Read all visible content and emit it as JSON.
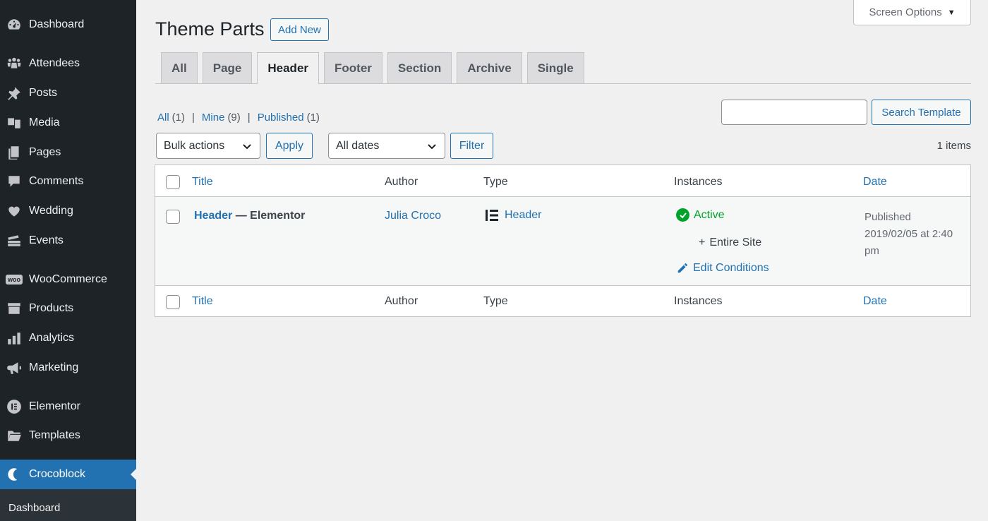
{
  "sidebar": {
    "items": [
      {
        "label": "Dashboard",
        "icon": "dashboard-icon"
      },
      {
        "label": "Attendees",
        "icon": "groups-icon"
      },
      {
        "label": "Posts",
        "icon": "pin-icon"
      },
      {
        "label": "Media",
        "icon": "media-icon"
      },
      {
        "label": "Pages",
        "icon": "pages-icon"
      },
      {
        "label": "Comments",
        "icon": "comments-icon"
      },
      {
        "label": "Wedding",
        "icon": "heart-icon"
      },
      {
        "label": "Events",
        "icon": "tickets-icon"
      },
      {
        "label": "WooCommerce",
        "icon": "woo-icon"
      },
      {
        "label": "Products",
        "icon": "archive-icon"
      },
      {
        "label": "Analytics",
        "icon": "chart-bar-icon"
      },
      {
        "label": "Marketing",
        "icon": "megaphone-icon"
      },
      {
        "label": "Elementor",
        "icon": "elementor-icon"
      },
      {
        "label": "Templates",
        "icon": "folder-icon"
      },
      {
        "label": "Crocoblock",
        "icon": "crocoblock-icon"
      }
    ],
    "submenu": {
      "label": "Dashboard"
    },
    "woo_badge": "woo"
  },
  "screen_options": {
    "label": "Screen Options"
  },
  "header": {
    "title": "Theme Parts",
    "add_new": "Add New"
  },
  "tabs": [
    "All",
    "Page",
    "Header",
    "Footer",
    "Section",
    "Archive",
    "Single"
  ],
  "active_tab": "Header",
  "filters": {
    "all": "All",
    "all_count": "(1)",
    "mine": "Mine",
    "mine_count": "(9)",
    "published": "Published",
    "published_count": "(1)",
    "sep": "|"
  },
  "search": {
    "placeholder": "",
    "button": "Search Template"
  },
  "toolbar": {
    "bulk_actions": "Bulk actions",
    "apply": "Apply",
    "dates": "All dates",
    "filter": "Filter",
    "items_count": "1 items"
  },
  "table": {
    "columns": [
      "Title",
      "Author",
      "Type",
      "Instances",
      "Date"
    ],
    "rows": [
      {
        "title": "Header",
        "title_suffix": "— Elementor",
        "author": "Julia Croco",
        "type": "Header",
        "instance_status": "Active",
        "instance_condition": "Entire Site",
        "edit_conditions": "Edit Conditions",
        "date_status": "Published",
        "date_line1": "2019/02/05 at 2:40",
        "date_line2": "pm"
      }
    ]
  },
  "colors": {
    "accent": "#2271b1",
    "sidebar_bg": "#1d2327",
    "active_green": "#00a32a"
  }
}
